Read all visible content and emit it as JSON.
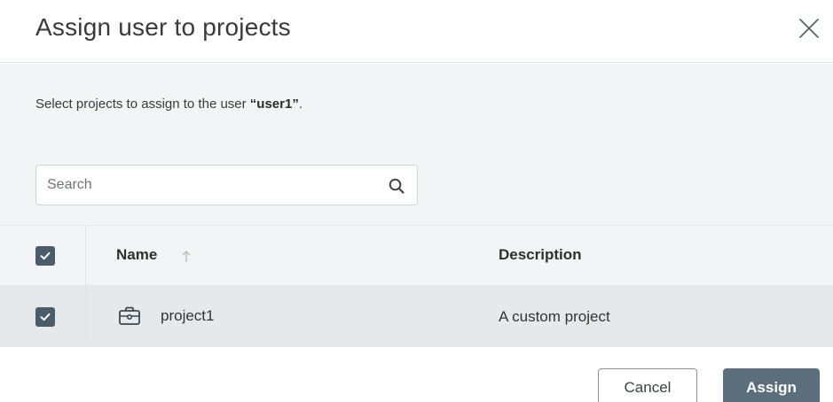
{
  "dialog": {
    "title": "Assign user to projects",
    "intro_prefix": "Select projects to assign to the user ",
    "intro_user": "“user1”",
    "intro_suffix": "."
  },
  "search": {
    "placeholder": "Search",
    "value": ""
  },
  "table": {
    "columns": [
      {
        "label": "Name",
        "sort": "ascending"
      },
      {
        "label": "Description"
      }
    ],
    "select_all_checked": true,
    "rows": [
      {
        "name": "project1",
        "description": "A custom project",
        "checked": true,
        "icon": "briefcase-icon"
      }
    ]
  },
  "footer": {
    "cancel_label": "Cancel",
    "assign_label": "Assign"
  },
  "colors": {
    "accent": "#5a6e7c",
    "checkbox": "#4a5c6a",
    "panel_bg": "#f2f4f5",
    "selected_row_bg": "#e6e9eb"
  }
}
